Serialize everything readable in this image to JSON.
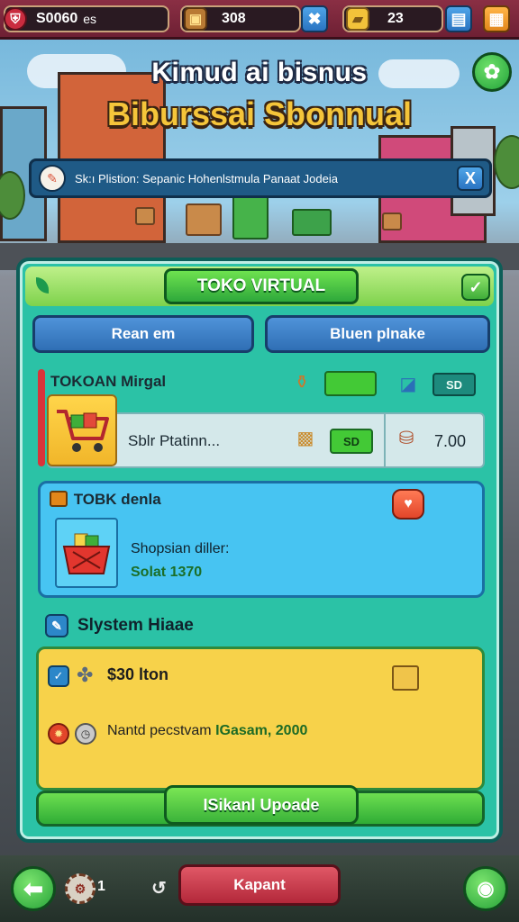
{
  "hud": {
    "currency_main": "S0060",
    "currency_main_suffix": "es",
    "crates": "308",
    "gold": "23",
    "icons": [
      "shield-icon",
      "treasure-chest-icon",
      "tools-icon",
      "gold-bars-icon",
      "chart-icon",
      "box-icon"
    ]
  },
  "header": {
    "title_line1": "Kimud ai bisnus",
    "title_line2": "Biburssai Sbonnual"
  },
  "notice": {
    "text": "Sk:ı Plistion: Sepanic Hohenlstmula Panaat Jodeia",
    "close_label": "X"
  },
  "panel": {
    "title": "TOKO VIRTUAL",
    "close_label": "✓",
    "tabs": [
      {
        "label": "Rean em"
      },
      {
        "label": "Bluen plnake"
      }
    ]
  },
  "store1": {
    "name": "TOKOAN Mirgal",
    "top_price": "SD",
    "product": "Sblr Ptatinn...",
    "product_price": "SD",
    "product_cost": "7.00"
  },
  "store2": {
    "name": "TOBK denla",
    "desc": "Shopsian diller:",
    "stock": "Solat 1370"
  },
  "system": {
    "label": "Slystem Hiaae"
  },
  "upgrade": {
    "cost": "$30 lton",
    "detail_prefix": "Nantd pecstvam ",
    "detail_highlight": "IGasam, 2000",
    "button_label": "ISikanl Upoade"
  },
  "bottom": {
    "gear_count": "1",
    "exit_label": "Kapant"
  },
  "colors": {
    "panel": "#2bc2a6",
    "accent_green": "#3bb33a",
    "hud_bar": "#8a2f44",
    "upgrade_card": "#f7d24a",
    "exit_button": "#b3283a"
  }
}
